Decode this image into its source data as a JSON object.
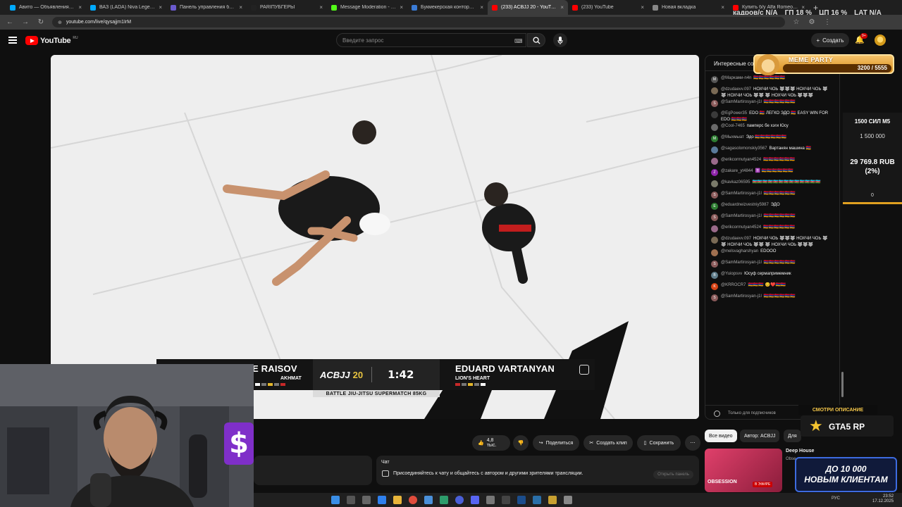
{
  "browser": {
    "tabs": [
      {
        "title": "Авито — Объявления на сай",
        "color": "#00aaff"
      },
      {
        "title": "ВАЗ (LADA) Niva Legend Spor",
        "color": "#00aaff"
      },
      {
        "title": "Панель управления баттонб",
        "color": "#6a5acd"
      },
      {
        "title": "PARIПУБГЕРЫ",
        "color": "#222222"
      },
      {
        "title": "Message Moderation - Kick D",
        "color": "#53fc18"
      },
      {
        "title": "Букмекерская контора BetBo",
        "color": "#3a7bd5"
      },
      {
        "title": "(233) ACBJJ 20 - YouTube",
        "color": "#ff0000"
      },
      {
        "title": "(233) YouTube",
        "color": "#ff0000"
      },
      {
        "title": "Новая вкладка",
        "color": "#888888"
      },
      {
        "title": "Купить б/у Alfa Romeo Giuli",
        "color": "#ff0000"
      }
    ],
    "new_tab": "+",
    "url": "youtube.com/live/qysajjm1IrM"
  },
  "perf": {
    "fps_label": "кадров/с",
    "fps": "N/A",
    "gpu_label": "ГП",
    "gpu": "18 %",
    "cpu_label": "ЦП",
    "cpu": "16 %",
    "lat_label": "LAT",
    "lat": "N/A"
  },
  "youtube": {
    "logo": "YouTube",
    "region": "RU",
    "search_placeholder": "Введите запрос",
    "create": "Создать",
    "notif_count": "9+"
  },
  "scoreboard": {
    "left_name": "E RAISOV",
    "left_team": "AKHMAT",
    "event": "ACBJJ",
    "event_num": "20",
    "clock": "1:42",
    "subtitle": "BATTLE JIU-JITSU SUPERMATCH 85KG",
    "right_name": "EDUARD VARTANYAN",
    "right_team": "LION'S HEART"
  },
  "actions": {
    "likes": "4,8 тыс.",
    "share": "Поделиться",
    "clip": "Создать клип",
    "save": "Сохранить",
    "more": "⋯"
  },
  "chat_panel": {
    "title": "Чат",
    "prompt": "Присоединяйтесь к чату и общайтесь с автором и другими зрителями трансляции.",
    "open": "Открыть панель"
  },
  "live_chat": {
    "header": "Интересные со",
    "footer": "Только для подписчиков",
    "messages": [
      {
        "author": "@Марками-n4n",
        "text": "🇦🇲🇦🇲🇦🇲🇦🇲🇦🇲🇦🇲",
        "initial": "M",
        "color": "#555555"
      },
      {
        "author": "@dzudaevv.097",
        "text": "НОХЧИ ЧОЬ 🐺🐺🐺 НОХЧИ ЧОЬ 🐺🐺 НОХЧИ ЧОЬ 🐺🐺 🐺 НОХЧИ ЧОЬ 🐺🐺🐺",
        "initial": "",
        "color": "#7a6a55"
      },
      {
        "author": "@SamMartirosyan-j1l",
        "text": "🇦🇲🇦🇲🇦🇲🇦🇲🇦🇲🇦🇲",
        "initial": "S",
        "color": "#8a5a5a"
      },
      {
        "author": "@EgPower35",
        "text": "EDO 🇦🇲 ЛЕГКО ЭДО 🇦🇲 EASY WIN FOR EDO 🇦🇲🇦🇲🇦🇲",
        "initial": "",
        "color": "#3a3a3a"
      },
      {
        "author": "@Cool-7465",
        "text": "памперс бе хэги Юсу",
        "initial": "",
        "color": "#6a6a6a"
      },
      {
        "author": "@Мыхмыат",
        "text": "Эдо 🇦🇲🇦🇲🇦🇲🇦🇲🇦🇲🇦🇲",
        "initial": "M",
        "color": "#2e7d32"
      },
      {
        "author": "@sagasolomonskiy3567",
        "text": "Вартанян машина 🇦🇲",
        "initial": "",
        "color": "#5a7a9a"
      },
      {
        "author": "@erikcormutyan4524",
        "text": "🇦🇲🇦🇲🇦🇲🇦🇲🇦🇲🇦🇲",
        "initial": "",
        "color": "#9a6a8a"
      },
      {
        "author": "@zakare_yt4844",
        "text": "✝️ 🇦🇲🇦🇲🇦🇲🇦🇲🇦🇲🇦🇲",
        "initial": "Z",
        "color": "#8e24aa"
      },
      {
        "author": "@kavkaz06595",
        "text": "🇦🇿🇦🇿🇦🇿🇦🇿🇦🇿🇦🇿🇦🇿🇦🇿🇦🇿🇦🇿🇦🇿🇦🇿🇦🇿",
        "initial": "",
        "color": "#7a7a6a"
      },
      {
        "author": "@SamMartirosyan-j1l",
        "text": "🇦🇲🇦🇲🇦🇲🇦🇲🇦🇲🇦🇲",
        "initial": "S",
        "color": "#8a5a5a"
      },
      {
        "author": "@eduardneizvestniy5987",
        "text": "ЭДО",
        "initial": "E",
        "color": "#2e7d32"
      },
      {
        "author": "@SamMartirosyan-j1l",
        "text": "🇦🇲🇦🇲🇦🇲🇦🇲🇦🇲🇦🇲",
        "initial": "S",
        "color": "#8a5a5a"
      },
      {
        "author": "@erikcormutyan4524",
        "text": "🇦🇲🇦🇲🇦🇲🇦🇲🇦🇲🇦🇲",
        "initial": "",
        "color": "#9a6a8a"
      },
      {
        "author": "@dzudaevv.097",
        "text": "НОХЧИ ЧОЬ 🐺🐺🐺 НОХЧИ ЧОЬ 🐺🐺 НОХЧИ ЧОЬ 🐺🐺 🐺 НОХЧИ ЧОЬ 🐺🐺🐺",
        "initial": "",
        "color": "#7a6a55"
      },
      {
        "author": "@melsvagharshyan",
        "text": "EDOOO",
        "initial": "",
        "color": "#a07050"
      },
      {
        "author": "@SamMartirosyan-j1l",
        "text": "🇦🇲🇦🇲🇦🇲🇦🇲🇦🇲🇦🇲",
        "initial": "S",
        "color": "#8a5a5a"
      },
      {
        "author": "@Yuiopsvv",
        "text": "Юсуф сермапримемник",
        "initial": "B",
        "color": "#607d8b"
      },
      {
        "author": "@KRROCR7",
        "text": "🇦🇲🇦🇲🇦🇲 😊❤️🇦🇲🇦🇲",
        "initial": "K",
        "color": "#d84315"
      },
      {
        "author": "@SamMartirosyan-j1l",
        "text": "🇦🇲🇦🇲🇦🇲🇦🇲🇦🇲🇦🇲",
        "initial": "S",
        "color": "#8a5a5a"
      }
    ]
  },
  "widgets": {
    "meme_title": "MEME PARTY",
    "meme_value": "3200 / 5555",
    "goal_title": "1500 СИЛ М5",
    "goal_target": "1 500 000",
    "goal_current": "29 769.8 RUB",
    "goal_percent": "(2%)",
    "goal_zero": "0",
    "gta_desc": "СМОТРИ ОПИСАНИЕ",
    "gta_logo": "GTA5 RP",
    "gta_promo_1": "ДО 10 000",
    "gta_promo_2": "НОВЫМ КЛИЕНТАМ"
  },
  "filters": {
    "all": "Все видео",
    "author": "Автор: ACBJJ",
    "more": "Для"
  },
  "recommend": {
    "title": "Deep House",
    "sub": "Obse",
    "thumb_text": "OBSESSION",
    "live": "В ЭФИРЕ"
  },
  "taskbar": {
    "lang": "РУС",
    "time": "23:52",
    "date": "17.12.2025"
  }
}
